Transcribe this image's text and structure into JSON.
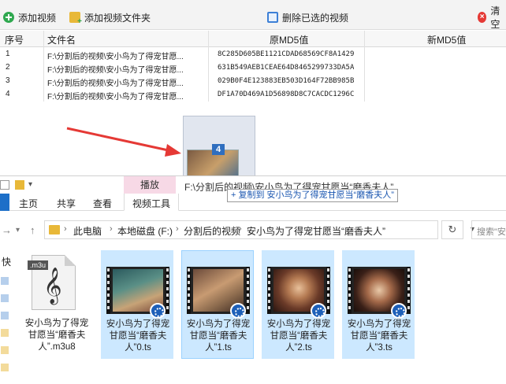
{
  "app": {
    "toolbar": {
      "add_video": "添加视频",
      "add_folder": "添加视频文件夹",
      "delete_selected": "删除已选的视频",
      "clear": "清空"
    },
    "table": {
      "headers": [
        "序号",
        "文件名",
        "原MD5值",
        "新MD5值"
      ],
      "rows": [
        {
          "index": "1",
          "file": "F:\\分割后的视频\\安小鸟为了得宠甘愿...",
          "md5": "8C285D605BE1121CDAD68569CF8A1429",
          "new_md5": ""
        },
        {
          "index": "2",
          "file": "F:\\分割后的视频\\安小鸟为了得宠甘愿...",
          "md5": "631B549AEB1CEAE64D8465299733DA5A",
          "new_md5": ""
        },
        {
          "index": "3",
          "file": "F:\\分割后的视频\\安小鸟为了得宠甘愿...",
          "md5": "029B0F4E123883EB503D164F72BB985B",
          "new_md5": ""
        },
        {
          "index": "4",
          "file": "F:\\分割后的视频\\安小鸟为了得宠甘愿...",
          "md5": "DF1A70D469A1D56898D8C7CACDC1296C",
          "new_md5": ""
        }
      ]
    },
    "drag": {
      "count": "4",
      "label": "F:\\分割后的视频\\安小鸟为了得宠甘愿当“磨香夫人”",
      "tooltip": "+ 复制到 安小鸟为了得宠甘愿当“磨香夫人”"
    }
  },
  "explorer": {
    "context_tab": "播放",
    "ribbon_tabs": [
      "主页",
      "共享",
      "查看",
      "视频工具"
    ],
    "breadcrumb": [
      "此电脑",
      "本地磁盘 (F:)",
      "分割后的视频",
      "安小鸟为了得宠甘愿当“磨香夫人”"
    ],
    "search_placeholder": "搜索\"安",
    "nav_label": "快",
    "files": [
      {
        "name": "安小鸟为了得宠甘愿当“磨香夫人”.m3u8",
        "tag": ".m3u",
        "type": "m3u8"
      },
      {
        "name": "安小鸟为了得宠甘愿当“磨香夫人”0.ts",
        "type": "ts"
      },
      {
        "name": "安小鸟为了得宠甘愿当“磨香夫人”1.ts",
        "type": "ts"
      },
      {
        "name": "安小鸟为了得宠甘愿当“磨香夫人”2.ts",
        "type": "ts"
      },
      {
        "name": "安小鸟为了得宠甘愿当“磨香夫人”3.ts",
        "type": "ts"
      }
    ]
  },
  "colors": {
    "selection": "#cce8ff",
    "context_tab": "#f7d9e6",
    "arrow": "#e53935",
    "badge": "#1d5fb8"
  }
}
